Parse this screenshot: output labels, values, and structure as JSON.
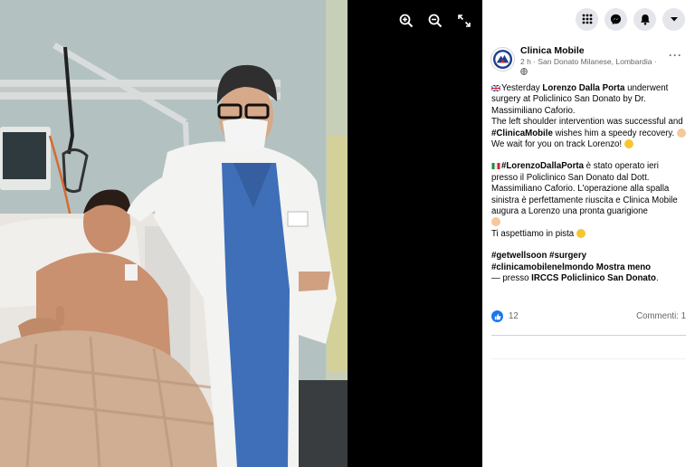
{
  "viewer": {
    "tools": [
      {
        "icon": "zoom-in-icon"
      },
      {
        "icon": "zoom-out-icon"
      },
      {
        "icon": "fullscreen-icon"
      }
    ]
  },
  "topnav": {
    "buttons": [
      {
        "icon": "menu-grid-icon"
      },
      {
        "icon": "messenger-icon"
      },
      {
        "icon": "notifications-bell-icon"
      },
      {
        "icon": "account-caret-icon"
      }
    ]
  },
  "post": {
    "page_name": "Clinica Mobile",
    "meta": "2 h · San Donato Milanese, Lombardia ·",
    "en": {
      "t1": "Yesterday ",
      "name": "Lorenzo Dalla Porta",
      "t2": " underwent surgery at Policlinico San Donato by Dr. Massimiliano Caforio.",
      "t3": "The left shoulder intervention was successful and ",
      "hashtag": "#ClinicaMobile",
      "t4": " wishes him a speedy recovery.",
      "t5": "We wait for you on track Lorenzo!"
    },
    "it": {
      "hashtag": "#LorenzoDallaPorta",
      "t1": " è stato operato ieri presso il Policlinico San Donato dal Dott. Massimiliano Caforio. L'operazione alla spalla sinistra è perfettamente riuscita e Clinica Mobile augura a Lorenzo una pronta guarigione",
      "t2": "Ti aspettiamo in pista"
    },
    "tags": "#getwellsoon #surgery #clinicamobilenelmondo",
    "show_less": "Mostra meno",
    "location_prefix": "— presso ",
    "location": "IRCCS Policlinico San Donato",
    "location_suffix": "."
  },
  "reactions": {
    "likes": "12",
    "comments": "Commenti: 1"
  },
  "colors": {
    "accent": "#1877f2",
    "nav_button_bg": "#e4e6eb",
    "secondary_text": "#65676b"
  }
}
